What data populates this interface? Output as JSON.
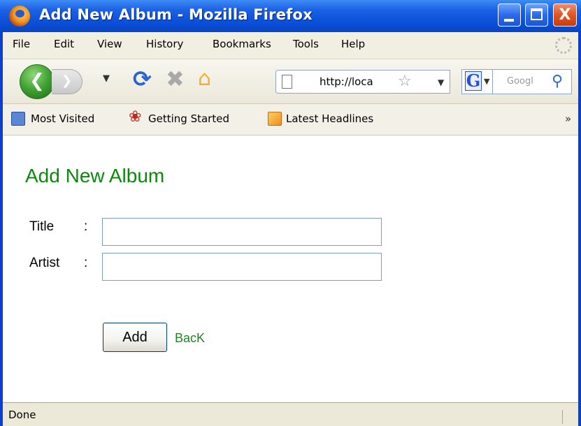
{
  "window": {
    "title": "Add New Album - Mozilla Firefox",
    "minimize_label": "",
    "close_label": "X"
  },
  "menu": [
    "File",
    "Edit",
    "View",
    "History",
    "Bookmarks",
    "Tools",
    "Help"
  ],
  "nav": {
    "url": "http://loca",
    "search_placeholder": "Googl",
    "search_engine": "G"
  },
  "bookmarks": {
    "items": [
      "Most Visited",
      "Getting Started",
      "Latest Headlines"
    ],
    "overflow": "»"
  },
  "page": {
    "title": "Add New Album",
    "title_label": "Title",
    "artist_label": "Artist",
    "colon": ":",
    "title_value": "",
    "artist_value": "",
    "add_button": "Add",
    "back_link": "BacK"
  },
  "status": {
    "text": "Done"
  },
  "colors": {
    "title_green": "#0a8a0a",
    "link_green": "#1a8a1a",
    "titlebar_blue": "#0a50d8"
  },
  "icons": [
    "firefox-logo",
    "back-arrow-icon",
    "forward-arrow-icon",
    "reload-icon",
    "stop-icon",
    "home-icon",
    "page-icon",
    "bookmark-star-icon",
    "google-icon",
    "search-icon",
    "bookmarks-folder-icon",
    "getting-started-icon",
    "rss-feed-icon"
  ]
}
